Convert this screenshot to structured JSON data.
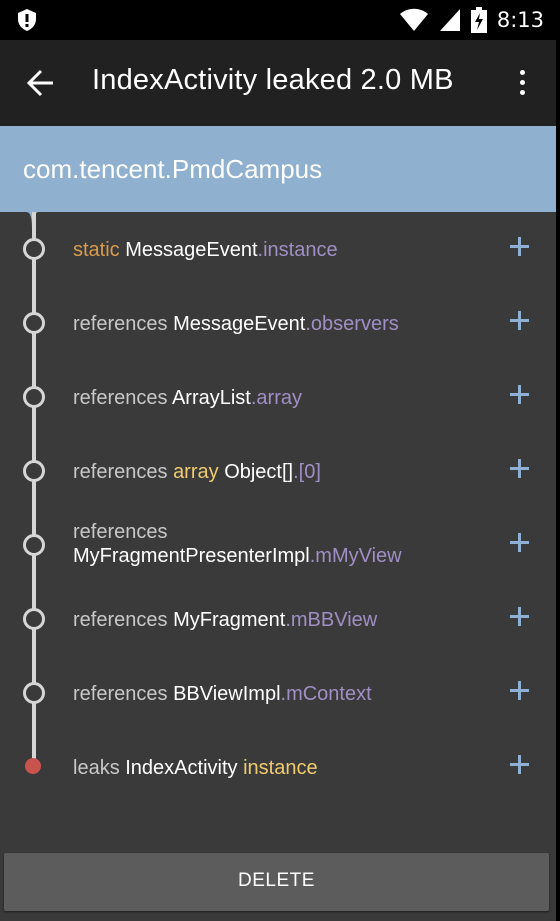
{
  "status_bar": {
    "time": "8:13",
    "icons": [
      "shield-icon",
      "wifi-icon",
      "signal-icon",
      "battery-charging-icon"
    ]
  },
  "app_bar": {
    "title": "IndexActivity leaked 2.0 MB",
    "back_icon": "arrow-back-icon",
    "overflow_icon": "more-vert-icon"
  },
  "header": {
    "package": "com.tencent.PmdCampus"
  },
  "trace": [
    {
      "parts": [
        {
          "text": "static ",
          "color": "orange"
        },
        {
          "text": "MessageEvent",
          "color": "white"
        },
        {
          "text": ".instance",
          "color": "purple"
        }
      ]
    },
    {
      "parts": [
        {
          "text": "references ",
          "color": "gray"
        },
        {
          "text": "MessageEvent",
          "color": "white"
        },
        {
          "text": ".observers",
          "color": "purple"
        }
      ]
    },
    {
      "parts": [
        {
          "text": "references ",
          "color": "gray"
        },
        {
          "text": "ArrayList",
          "color": "white"
        },
        {
          "text": ".array",
          "color": "purple"
        }
      ]
    },
    {
      "parts": [
        {
          "text": "references ",
          "color": "gray"
        },
        {
          "text": "array ",
          "color": "yellow"
        },
        {
          "text": "Object[]",
          "color": "white"
        },
        {
          "text": ".[0]",
          "color": "purple"
        }
      ]
    },
    {
      "parts": [
        {
          "text": "references",
          "color": "gray"
        },
        {
          "text": "MyFragmentPresenterImpl",
          "color": "white"
        },
        {
          "text": ".mMyView",
          "color": "purple"
        }
      ]
    },
    {
      "parts": [
        {
          "text": "references ",
          "color": "gray"
        },
        {
          "text": "MyFragment",
          "color": "white"
        },
        {
          "text": ".mBBView",
          "color": "purple"
        }
      ]
    },
    {
      "parts": [
        {
          "text": "references ",
          "color": "gray"
        },
        {
          "text": "BBViewImpl",
          "color": "white"
        },
        {
          "text": ".mContext",
          "color": "purple"
        }
      ]
    },
    {
      "parts": [
        {
          "text": "leaks ",
          "color": "gray"
        },
        {
          "text": "IndexActivity ",
          "color": "white"
        },
        {
          "text": "instance",
          "color": "yellow"
        }
      ]
    }
  ],
  "expand_icon": "plus-icon",
  "delete_button": {
    "label": "DELETE"
  },
  "colors": {
    "header_bg": "#8fb0cf",
    "appbar_bg": "#212121",
    "list_bg": "#3a3a3a",
    "accent_plus": "#8db0d4",
    "leak_dot": "#c9544d"
  }
}
